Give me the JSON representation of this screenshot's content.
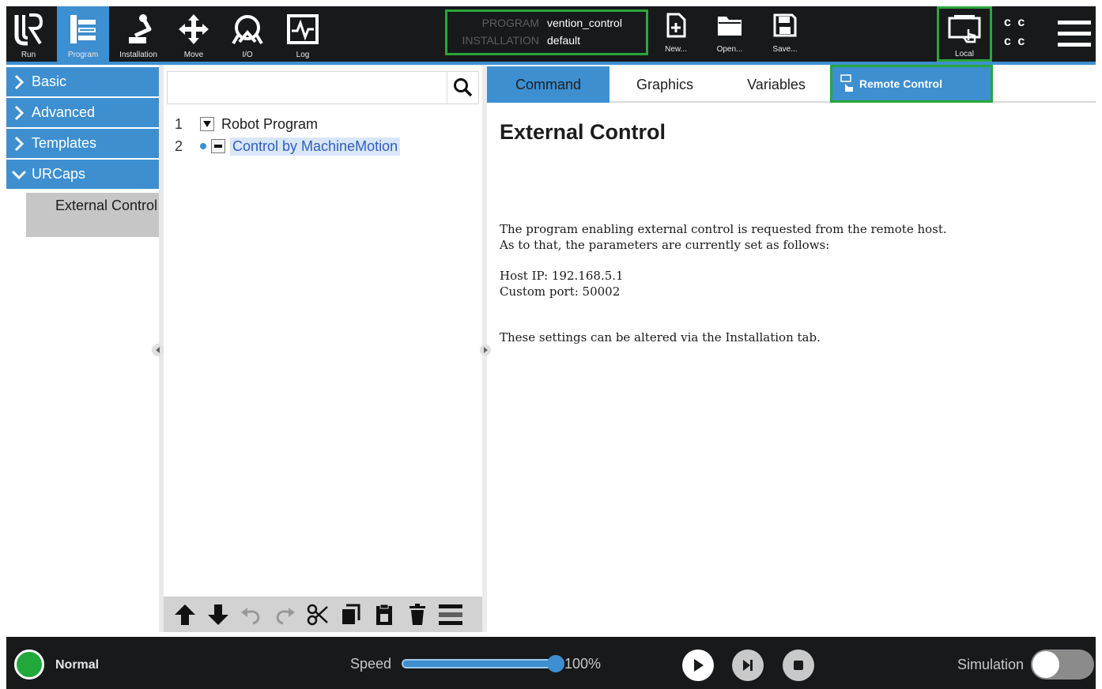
{
  "header": {
    "nav": [
      {
        "label": "Run",
        "icon": "ur-logo-icon"
      },
      {
        "label": "Program",
        "icon": "program-tree-icon"
      },
      {
        "label": "Installation",
        "icon": "robot-arm-icon"
      },
      {
        "label": "Move",
        "icon": "move-cross-icon"
      },
      {
        "label": "I/O",
        "icon": "io-icon"
      },
      {
        "label": "Log",
        "icon": "log-icon"
      }
    ],
    "program": {
      "key": "PROGRAM",
      "value": "vention_control"
    },
    "installation": {
      "key": "INSTALLATION",
      "value": "default"
    },
    "file_actions": [
      {
        "label": "New...",
        "icon": "new-file-icon"
      },
      {
        "label": "Open...",
        "icon": "open-folder-icon"
      },
      {
        "label": "Save...",
        "icon": "save-icon"
      }
    ],
    "local": {
      "label": "Local",
      "icon": "local-control-icon"
    },
    "cc_text": [
      "c c",
      "c c"
    ],
    "menu_icon": "hamburger-menu-icon"
  },
  "sidebar": {
    "items": [
      {
        "label": "Basic",
        "expanded": false
      },
      {
        "label": "Advanced",
        "expanded": false
      },
      {
        "label": "Templates",
        "expanded": false
      },
      {
        "label": "URCaps",
        "expanded": true
      }
    ],
    "subitem": "External Control"
  },
  "tree": {
    "rows": [
      {
        "num": "1",
        "label": "Robot Program"
      },
      {
        "num": "2",
        "label": "Control by MachineMotion"
      }
    ],
    "toolbar_icons": [
      "move-up-icon",
      "move-down-icon",
      "undo-icon",
      "redo-icon",
      "cut-icon",
      "copy-icon",
      "paste-icon",
      "delete-icon",
      "suppress-icon"
    ]
  },
  "tabs": [
    {
      "label": "Command",
      "active": true
    },
    {
      "label": "Graphics",
      "active": false
    },
    {
      "label": "Variables",
      "active": false
    },
    {
      "label": "Remote Control",
      "active": false
    }
  ],
  "content": {
    "title": "External Control",
    "line1": "The program enabling external control is requested from the remote host.",
    "line2": "As to that, the parameters are currently set as follows:",
    "host_ip": "Host IP: 192.168.5.1",
    "custom_port": "Custom port: 50002",
    "footer_note": "These settings can be altered via the Installation tab."
  },
  "footer": {
    "status": "Normal",
    "speed_label": "Speed",
    "speed_value": "100%",
    "speed_fraction": 1.0,
    "simulation_label": "Simulation",
    "simulation_on": false
  },
  "colors": {
    "accent": "#3d8fd0",
    "highlight": "#2aa63a",
    "header_bg": "#17191b",
    "status_green": "#22a83a"
  }
}
